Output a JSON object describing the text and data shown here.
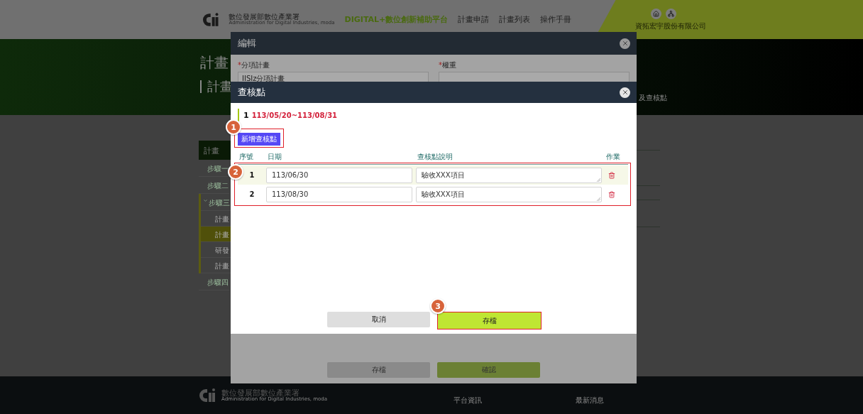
{
  "header": {
    "org_name": "數位發展部數位產業署",
    "org_name_en": "Administration for Digital Industries, moda",
    "platform": "DIGITAL+數位創新補助平台",
    "nav": [
      "計畫申請",
      "計畫列表",
      "操作手冊"
    ],
    "company": "資拓宏宇股份有限公司"
  },
  "hero": {
    "title": "計畫",
    "subtitle": "計畫",
    "breadcrumb": "及查核點"
  },
  "sidebar": {
    "header": "計畫",
    "items": [
      {
        "label": "步驟一"
      },
      {
        "label": "步驟二"
      },
      {
        "label": "步驟三",
        "expanded": true,
        "children": [
          {
            "label": "計畫",
            "selected": false
          },
          {
            "label": "計畫",
            "selected": true
          },
          {
            "label": "研發",
            "selected": false
          },
          {
            "label": "計畫",
            "selected": false
          }
        ]
      },
      {
        "label": "步驟四"
      }
    ]
  },
  "edit_dialog": {
    "title": "編輯",
    "fields": [
      {
        "required_mark": "*",
        "label": "分項計畫",
        "value": "IISIz分項計畫"
      },
      {
        "required_mark": "*",
        "label": "權重"
      }
    ],
    "buttons": [
      {
        "label": "存檔",
        "kind": "secondary"
      },
      {
        "label": "確認",
        "kind": "primary"
      }
    ]
  },
  "checkpoint_dialog": {
    "title": "查核點",
    "period": {
      "index": "1",
      "range": "113/05/20~113/08/31"
    },
    "add_button": {
      "label": "新增查核點",
      "badge": "1"
    },
    "table": {
      "badge": "2",
      "columns": [
        "序號",
        "日期",
        "查核點說明",
        "作業"
      ],
      "rows": [
        {
          "seq": "1",
          "date": "113/06/30",
          "description": "驗收XXX項目"
        },
        {
          "seq": "2",
          "date": "113/08/30",
          "description": "驗收XXX項目"
        }
      ]
    },
    "buttons": [
      {
        "label": "取消",
        "kind": "secondary"
      },
      {
        "label": "存檔",
        "kind": "primary",
        "badge": "3"
      }
    ]
  },
  "footer": {
    "org_name": "數位發展部數位產業署",
    "org_name_en": "Administration for Digital Industries, moda",
    "links": [
      "平台資訊",
      "最新消息"
    ]
  }
}
